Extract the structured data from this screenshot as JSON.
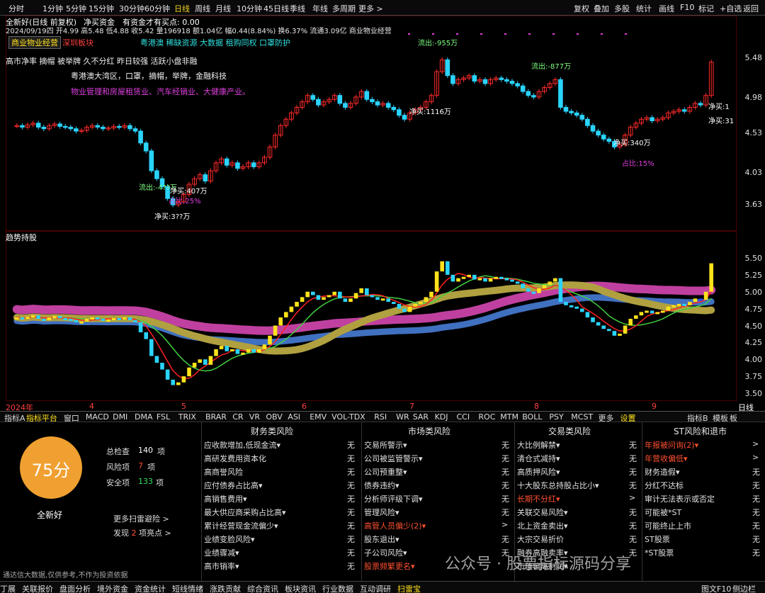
{
  "top_periods": [
    "分时",
    "1分钟",
    "5分钟",
    "15分钟",
    "30分钟",
    "60分钟",
    "日线",
    "周线",
    "月线",
    "10分钟",
    "45日线",
    "季线",
    "年线",
    "多周期",
    "更多 >"
  ],
  "top_right": [
    "复权",
    "叠加",
    "多股",
    "统计",
    "画线",
    "F10",
    "标记",
    "+自选",
    "返回"
  ],
  "stock": {
    "title": "全新好(日线 前复权)",
    "indicator": "净买资金",
    "indicator_text": "有资金才有买点: 0.00",
    "info_line": "2024/09/19四 开4.99 高5.48 低4.88 收5.42 量196918 额1.04亿 幅0.44(8.84%) 换6.37% 流通3.09亿 商业物业经营"
  },
  "labels": {
    "tag1": "商业物业经营",
    "tag2": "深圳板块",
    "concepts_line": "高市净率 摘帽 被举牌 久不分红 昨日较强 活跃小盘非融",
    "concepts_line2": "粤港澳大湾区，口罩，摘帽，举牌，金融科技",
    "business": "物业管理和房屋租赁业、汽车经销业、大健康产业。",
    "extra1": "粤港澳 稀缺资源 大数据 租购同权 口罩防护"
  },
  "annotations": [
    "流出:-4??万",
    "净买:407万",
    "占比:25%",
    "净买:3??万",
    "流出:-955万",
    "净买:1116万",
    "流出:-877万",
    "净买:340万",
    "占比:15%",
    "净买:1",
    "净买:31"
  ],
  "y_main": [
    "5.48",
    "4.98",
    "4.53",
    "4.03",
    "3.63"
  ],
  "y_ind": [
    "5.50",
    "5.25",
    "5.00",
    "4.75",
    "4.50",
    "4.25",
    "4.00",
    "3.75",
    "3.50"
  ],
  "ind_title": "趋势持股",
  "x_axis": [
    "2024年",
    "4",
    "5",
    "6",
    "7",
    "8",
    "9"
  ],
  "x_axis_right": "日线",
  "ind_tabs": [
    "指标A",
    "指标平台",
    "窗口",
    "MACD",
    "DMI",
    "DMA",
    "FSL",
    "TRIX",
    "BRAR",
    "CR",
    "VR",
    "OBV",
    "ASI",
    "EMV",
    "VOL-TDX",
    "RSI",
    "WR",
    "SAR",
    "KDJ",
    "CCI",
    "ROC",
    "MTM",
    "BOLL",
    "PSY",
    "MCST",
    "更多",
    "设置"
  ],
  "ind_tabs_right": [
    "指标B",
    "模板",
    "板"
  ],
  "risk": {
    "score": "75分",
    "name": "全新好",
    "total_label": "总检查",
    "total": "140",
    "unit": "项",
    "risk_label": "风险项",
    "risk_count": "7",
    "safe_label": "安全项",
    "safe_count": "133",
    "more": "更多扫雷避险 >",
    "find_a": "发现",
    "find_n": "2",
    "find_b": "项亮点 >",
    "disclaimer": "通达信大数据,仅供参考,不作为投资依据",
    "columns": [
      {
        "title": "财务类风险",
        "rows": [
          [
            "应收款增加,低现金流▾",
            "无"
          ],
          [
            "高研发费用资本化",
            "无"
          ],
          [
            "高商誉风险",
            "无"
          ],
          [
            "应付债券占比高▾",
            "无"
          ],
          [
            "高销售费用▾",
            "无"
          ],
          [
            "最大供应商采购占比高▾",
            "无"
          ],
          [
            "累计经营现金流偏少▾",
            "无"
          ],
          [
            "业绩变脸风险▾",
            "无"
          ],
          [
            "业绩骤减▾",
            "无"
          ],
          [
            "高市销率▾",
            "无"
          ]
        ]
      },
      {
        "title": "市场类风险",
        "rows": [
          [
            "交易所警示▾",
            "无"
          ],
          [
            "公司被监管警示▾",
            "无"
          ],
          [
            "公司预重整▾",
            "无"
          ],
          [
            "债券违约▾",
            "无"
          ],
          [
            "分析师评级下调▾",
            "无"
          ],
          [
            "管理风险▾",
            "无"
          ],
          [
            "高管人员偏少(2)▾",
            ">"
          ],
          [
            "股东退出▾",
            "无"
          ],
          [
            "子公司风险▾",
            "无"
          ],
          [
            "股票频繁更名▾",
            ""
          ]
        ]
      },
      {
        "title": "交易类风险",
        "rows": [
          [
            "大比例解禁▾",
            "无"
          ],
          [
            "清仓式减持▾",
            "无"
          ],
          [
            "高质押风险▾",
            "无"
          ],
          [
            "十大股东总持股占比小▾",
            "无"
          ],
          [
            "长期不分红▾",
            ">"
          ],
          [
            "关联交易风险▾",
            "无"
          ],
          [
            "北上资金卖出▾",
            "无"
          ],
          [
            "大宗交易折价",
            "无"
          ],
          [
            "融券高融卖率▾",
            "无"
          ],
          [
            "市值偏离利润▾",
            ""
          ]
        ]
      },
      {
        "title": "ST风险和退市",
        "rows": [
          [
            "年报被问询(2)▾",
            ">"
          ],
          [
            "年营收偏低▾",
            ">"
          ],
          [
            "财务造假▾",
            "无"
          ],
          [
            "分红不达标",
            "无"
          ],
          [
            "审计无法表示或否定",
            "无"
          ],
          [
            "可能被*ST",
            "无"
          ],
          [
            "可能终止上市",
            "无"
          ],
          [
            "ST股票",
            "无"
          ],
          [
            "*ST股票",
            "无"
          ],
          [
            "",
            ""
          ]
        ]
      }
    ]
  },
  "bottom_tabs": [
    "丁展",
    "关联报价",
    "盘面分析",
    "境外资金",
    "资金统计",
    "短线情绪",
    "涨跌贡献",
    "综合资讯",
    "板块资讯",
    "行业数据",
    "互动调研",
    "扫雷宝"
  ],
  "bottom_right": [
    "图文F10",
    "侧边栏"
  ],
  "watermark": "公众号 · 股票指标源码分享",
  "colors": {
    "up": "#ff2a2a",
    "down": "#2ad4ff",
    "yellow": "#ffe21a",
    "magenta": "#e040e0",
    "panel_border": "#8b0000",
    "score_orange": "#f0a030",
    "risk_red": "#ff5030"
  }
}
